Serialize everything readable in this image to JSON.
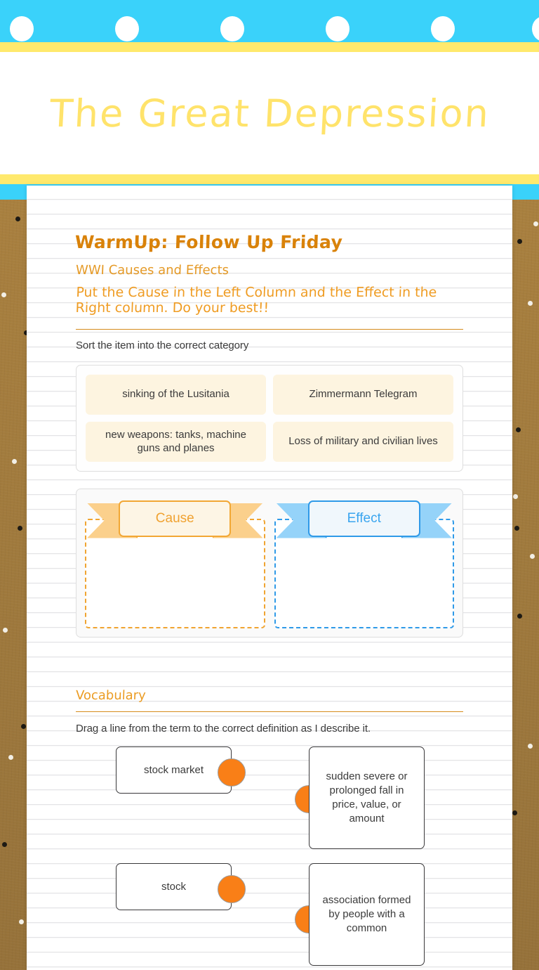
{
  "header": {
    "title": "The Great Depression",
    "title_color": "#ffe36b",
    "bar_cyan": "#3ad2fa",
    "bar_yellow": "#ffe96d",
    "dot_count": 6
  },
  "worksheet": {
    "heading": "WarmUp: Follow Up Friday",
    "subheading": "WWI Causes and Effects",
    "instructions": "Put the Cause in the Left Column and the Effect in the Right column. Do your best!!",
    "sort_prompt": "Sort the item into the correct category",
    "sort_items": [
      "sinking of the Lusitania",
      "Zimmermann Telegram",
      "new weapons: tanks, machine guns and planes",
      "Loss of military and civilian lives"
    ],
    "categories": [
      {
        "label": "Cause",
        "color": "#f0a231",
        "tail_color": "#fbd08c",
        "fold_color": "#f2a32f"
      },
      {
        "label": "Effect",
        "color": "#3aa5ef",
        "tail_color": "#95d3f9",
        "fold_color": "#2f97e3"
      }
    ]
  },
  "vocabulary": {
    "heading": "Vocabulary",
    "instructions": "Drag a line from the term to the correct definition as I describe it.",
    "accent_color": "#f97f17",
    "pairs": [
      {
        "term": "stock market",
        "definition": "sudden severe or prolonged fall in price, value, or amount"
      },
      {
        "term": "stock",
        "definition": "association formed by people with a common"
      }
    ]
  }
}
